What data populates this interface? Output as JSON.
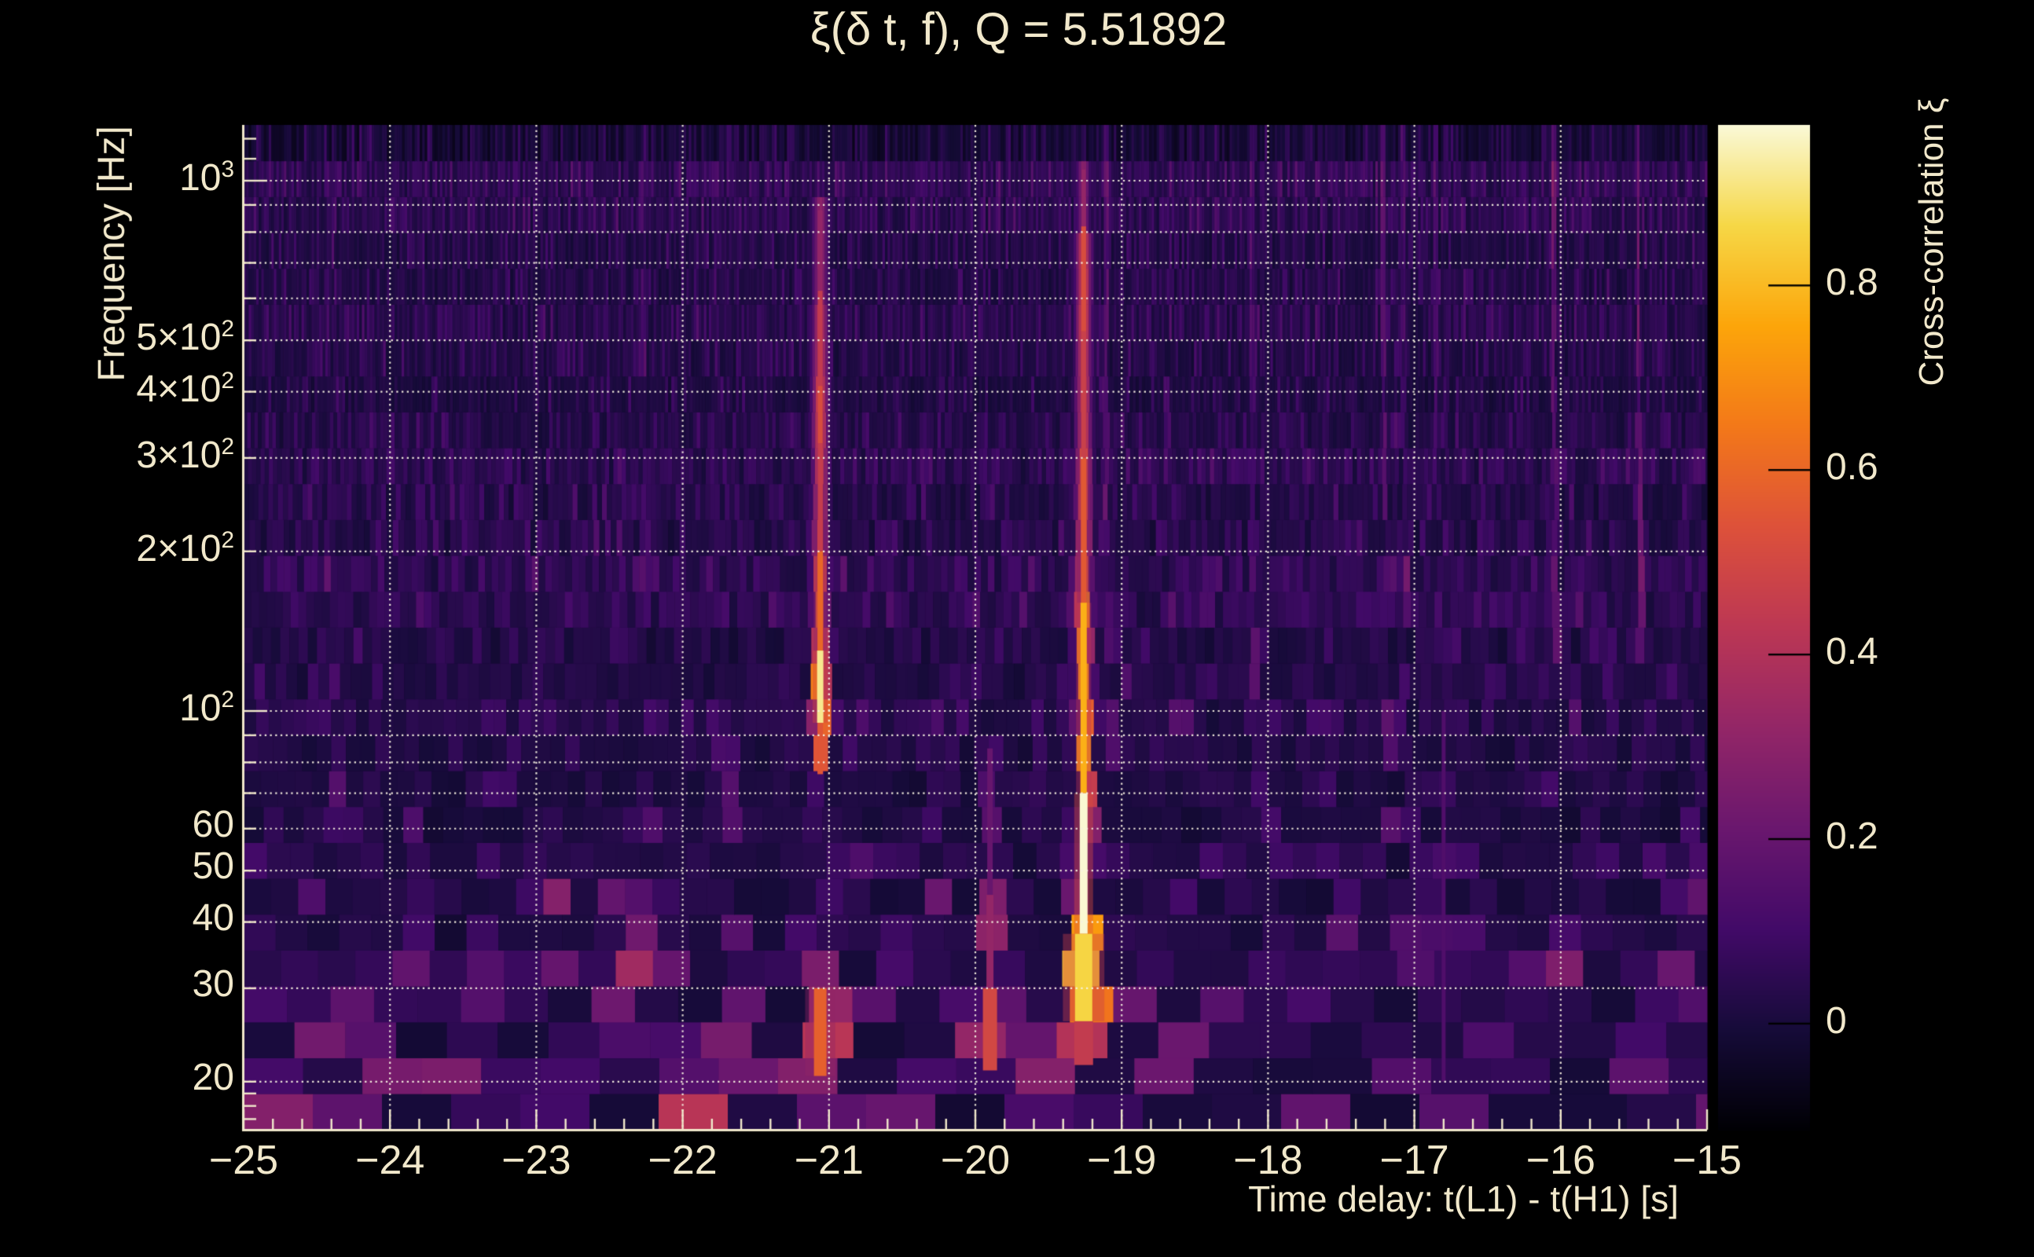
{
  "title": {
    "text": "ξ(δ t, f), Q = 5.51892"
  },
  "style": {
    "background": "#000000",
    "text_color": "#f1e8cb",
    "axis_color": "#f1e8cb",
    "grid_color": "rgba(247,241,224,0.95)",
    "colorbar_tick_color": "#000000",
    "colormap": "inferno"
  },
  "chart_data": {
    "type": "heatmap",
    "title": "ξ(δ t, f), Q = 5.51892",
    "q_value": 5.51892,
    "xlabel": "Time delay: t(L1) - t(H1) [s]",
    "ylabel": "Frequency [Hz]",
    "colorbar_label": "Cross-correlation ξ",
    "x_range": [
      -25,
      -15
    ],
    "f_range_hz": [
      16.24,
      1274
    ],
    "y_scale": "log",
    "z_range": [
      -0.115,
      0.974
    ],
    "grid": true,
    "x_major_ticks": [
      {
        "v": -25,
        "label": "−25"
      },
      {
        "v": -24,
        "label": "−24"
      },
      {
        "v": -23,
        "label": "−23"
      },
      {
        "v": -22,
        "label": "−22"
      },
      {
        "v": -21,
        "label": "−21"
      },
      {
        "v": -20,
        "label": "−20"
      },
      {
        "v": -19,
        "label": "−19"
      },
      {
        "v": -18,
        "label": "−18"
      },
      {
        "v": -17,
        "label": "−17"
      },
      {
        "v": -16,
        "label": "−16"
      },
      {
        "v": -15,
        "label": "−15"
      }
    ],
    "x_minor_step": 0.2,
    "y_tick_labels": [
      {
        "f": 1000,
        "text": "10",
        "sup": "3"
      },
      {
        "f": 500,
        "text": "5×10",
        "sup": "2"
      },
      {
        "f": 400,
        "text": "4×10",
        "sup": "2"
      },
      {
        "f": 300,
        "text": "3×10",
        "sup": "2"
      },
      {
        "f": 200,
        "text": "2×10",
        "sup": "2"
      },
      {
        "f": 100,
        "text": "10",
        "sup": "2"
      },
      {
        "f": 60,
        "text": "60"
      },
      {
        "f": 50,
        "text": "50"
      },
      {
        "f": 40,
        "text": "40"
      },
      {
        "f": 30,
        "text": "30"
      },
      {
        "f": 20,
        "text": "20"
      }
    ],
    "y_grid_hz": [
      20,
      30,
      40,
      50,
      60,
      70,
      80,
      90,
      100,
      200,
      300,
      400,
      500,
      600,
      700,
      800,
      900,
      1000
    ],
    "y_extra_tick_hz": [
      17,
      18,
      19,
      1100,
      1200
    ],
    "colorbar_ticks": [
      {
        "v": 0.8,
        "label": "0.8"
      },
      {
        "v": 0.6,
        "label": "0.6"
      },
      {
        "v": 0.4,
        "label": "0.4"
      },
      {
        "v": 0.2,
        "label": "0.2"
      },
      {
        "v": 0.0,
        "label": "0"
      }
    ],
    "noise_seed": 1337,
    "n_rows": 28,
    "events": [
      {
        "t": -21.06,
        "f1": 620,
        "f2": 900,
        "v": 0.3,
        "w": 0.05
      },
      {
        "t": -21.06,
        "f1": 410,
        "f2": 620,
        "v": 0.42,
        "w": 0.05
      },
      {
        "t": -21.06,
        "f1": 320,
        "f2": 410,
        "v": 0.5,
        "w": 0.05
      },
      {
        "t": -21.06,
        "f1": 200,
        "f2": 320,
        "v": 0.45,
        "w": 0.05
      },
      {
        "t": -21.06,
        "f1": 130,
        "f2": 200,
        "v": 0.58,
        "w": 0.05
      },
      {
        "t": -21.06,
        "f1": 95,
        "f2": 130,
        "v": 0.9,
        "w": 0.05
      },
      {
        "t": -21.06,
        "f1": 76,
        "f2": 95,
        "v": 0.55,
        "w": 0.05
      },
      {
        "t": -21.06,
        "f1": 30,
        "f2": 46,
        "v": 0.25,
        "w": 0.07
      },
      {
        "t": -21.06,
        "f1": 20,
        "f2": 30,
        "v": 0.55,
        "w": 0.1
      },
      {
        "t": -19.26,
        "f1": 620,
        "f2": 1100,
        "v": 0.3,
        "w": 0.04
      },
      {
        "t": -19.26,
        "f1": 520,
        "f2": 820,
        "v": 0.5,
        "w": 0.05
      },
      {
        "t": -19.26,
        "f1": 300,
        "f2": 520,
        "v": 0.46,
        "w": 0.05
      },
      {
        "t": -19.26,
        "f1": 160,
        "f2": 300,
        "v": 0.55,
        "w": 0.05
      },
      {
        "t": -19.26,
        "f1": 70,
        "f2": 160,
        "v": 0.75,
        "w": 0.05
      },
      {
        "t": -19.26,
        "f1": 38,
        "f2": 70,
        "v": 0.97,
        "w": 0.05
      },
      {
        "t": -19.26,
        "f1": 26,
        "f2": 38,
        "v": 0.85,
        "w": 0.1
      },
      {
        "t": -19.26,
        "f1": 21,
        "f2": 26,
        "v": 0.4,
        "w": 0.12
      },
      {
        "t": -19.26,
        "f1": 16.3,
        "f2": 20.5,
        "v": -0.1,
        "w": 0.1,
        "dark": true
      },
      {
        "t": -19.9,
        "f1": 45,
        "f2": 90,
        "v": 0.18,
        "w": 0.06
      },
      {
        "t": -19.9,
        "f1": 30,
        "f2": 45,
        "v": 0.3,
        "w": 0.08
      },
      {
        "t": -19.9,
        "f1": 21,
        "f2": 30,
        "v": 0.48,
        "w": 0.1
      },
      {
        "t": -22.86,
        "f1": 35,
        "f2": 52,
        "v": 0.28,
        "w": 0.05
      },
      {
        "t": -22.86,
        "f1": 20,
        "f2": 28,
        "v": 0.32,
        "w": 0.09
      },
      {
        "t": -24.72,
        "f1": 16.5,
        "f2": 20,
        "v": 0.3,
        "w": 0.12
      },
      {
        "t": -24.35,
        "f1": 55,
        "f2": 75,
        "v": 0.15,
        "w": 0.06
      },
      {
        "t": -24.19,
        "f1": 16.5,
        "f2": 22,
        "v": 0.45,
        "w": 0.1
      },
      {
        "t": -23.85,
        "f1": 30,
        "f2": 45,
        "v": 0.18,
        "w": 0.06
      },
      {
        "t": -23.55,
        "f1": 17,
        "f2": 21,
        "v": 0.28,
        "w": 0.12
      },
      {
        "t": -23.3,
        "f1": 25,
        "f2": 35,
        "v": 0.22,
        "w": 0.08
      },
      {
        "t": -22.35,
        "f1": 25,
        "f2": 40,
        "v": 0.38,
        "w": 0.1
      },
      {
        "t": -22.18,
        "f1": 19,
        "f2": 27,
        "v": 0.35,
        "w": 0.12
      },
      {
        "t": -21.97,
        "f1": 16.5,
        "f2": 20,
        "v": 0.45,
        "w": 0.12
      },
      {
        "t": -21.65,
        "f1": 24,
        "f2": 32,
        "v": 0.3,
        "w": 0.1
      },
      {
        "t": -21.67,
        "f1": 60,
        "f2": 90,
        "v": 0.14,
        "w": 0.05
      },
      {
        "t": -20.9,
        "f1": 17,
        "f2": 20,
        "v": 0.28,
        "w": 0.12
      },
      {
        "t": -20.42,
        "f1": 16.3,
        "f2": 18.5,
        "v": 0.45,
        "w": 0.1
      },
      {
        "t": -19.55,
        "f1": 20,
        "f2": 27,
        "v": 0.3,
        "w": 0.1
      },
      {
        "t": -18.98,
        "f1": 17,
        "f2": 20,
        "v": 0.28,
        "w": 0.1
      },
      {
        "t": -18.35,
        "f1": 21,
        "f2": 28,
        "v": 0.22,
        "w": 0.1
      },
      {
        "t": -17.93,
        "f1": 16.5,
        "f2": 19,
        "v": 0.3,
        "w": 0.1
      },
      {
        "t": -17.6,
        "f1": 17,
        "f2": 20,
        "v": 0.32,
        "w": 0.1
      },
      {
        "t": -17.5,
        "f1": 33,
        "f2": 48,
        "v": 0.16,
        "w": 0.06
      },
      {
        "t": -17.17,
        "f1": 18.5,
        "f2": 21.5,
        "v": 0.3,
        "w": 0.1
      },
      {
        "t": -16.8,
        "f1": 20,
        "f2": 100,
        "v": 0.1,
        "w": 0.035
      },
      {
        "t": -16.6,
        "f1": 16.5,
        "f2": 18.5,
        "v": 0.35,
        "w": 0.1
      },
      {
        "t": -16.4,
        "f1": 20,
        "f2": 26,
        "v": 0.26,
        "w": 0.1
      },
      {
        "t": -15.55,
        "f1": 17,
        "f2": 23,
        "v": 0.35,
        "w": 0.1
      },
      {
        "t": -15.33,
        "f1": 19,
        "f2": 28,
        "v": 0.45,
        "w": 0.1
      },
      {
        "t": -15.2,
        "f1": 27,
        "f2": 42,
        "v": 0.22,
        "w": 0.08
      },
      {
        "t": -15.1,
        "f1": 17,
        "f2": 19,
        "v": 0.28,
        "w": 0.1
      }
    ],
    "cores": [
      {
        "t": -21.06,
        "f1": 620,
        "f2": 880,
        "v": 0.32,
        "wpx": 6
      },
      {
        "t": -21.06,
        "f1": 410,
        "f2": 620,
        "v": 0.45,
        "wpx": 6
      },
      {
        "t": -21.06,
        "f1": 320,
        "f2": 410,
        "v": 0.52,
        "wpx": 6
      },
      {
        "t": -21.06,
        "f1": 200,
        "f2": 320,
        "v": 0.46,
        "wpx": 6
      },
      {
        "t": -21.06,
        "f1": 130,
        "f2": 200,
        "v": 0.6,
        "wpx": 7
      },
      {
        "t": -21.06,
        "f1": 95,
        "f2": 130,
        "v": 0.92,
        "wpx": 8
      },
      {
        "t": -21.06,
        "f1": 76,
        "f2": 95,
        "v": 0.55,
        "wpx": 7
      },
      {
        "t": -21.06,
        "f1": 20.5,
        "f2": 30,
        "v": 0.58,
        "wpx": 16
      },
      {
        "t": -19.26,
        "f1": 620,
        "f2": 1050,
        "v": 0.32,
        "wpx": 5
      },
      {
        "t": -19.26,
        "f1": 520,
        "f2": 820,
        "v": 0.52,
        "wpx": 6
      },
      {
        "t": -19.26,
        "f1": 300,
        "f2": 520,
        "v": 0.47,
        "wpx": 6
      },
      {
        "t": -19.26,
        "f1": 160,
        "f2": 300,
        "v": 0.56,
        "wpx": 7
      },
      {
        "t": -19.26,
        "f1": 70,
        "f2": 160,
        "v": 0.78,
        "wpx": 8
      },
      {
        "t": -19.26,
        "f1": 38,
        "f2": 70,
        "v": 0.97,
        "wpx": 10
      },
      {
        "t": -19.26,
        "f1": 26,
        "f2": 38,
        "v": 0.86,
        "wpx": 22
      },
      {
        "t": -19.26,
        "f1": 21.5,
        "f2": 26,
        "v": 0.45,
        "wpx": 24
      },
      {
        "t": -19.9,
        "f1": 45,
        "f2": 85,
        "v": 0.2,
        "wpx": 7
      },
      {
        "t": -19.9,
        "f1": 30,
        "f2": 45,
        "v": 0.32,
        "wpx": 9
      },
      {
        "t": -19.9,
        "f1": 21,
        "f2": 30,
        "v": 0.5,
        "wpx": 18
      },
      {
        "t": -16.8,
        "f1": 20,
        "f2": 100,
        "v": 0.14,
        "wpx": 5
      }
    ]
  }
}
